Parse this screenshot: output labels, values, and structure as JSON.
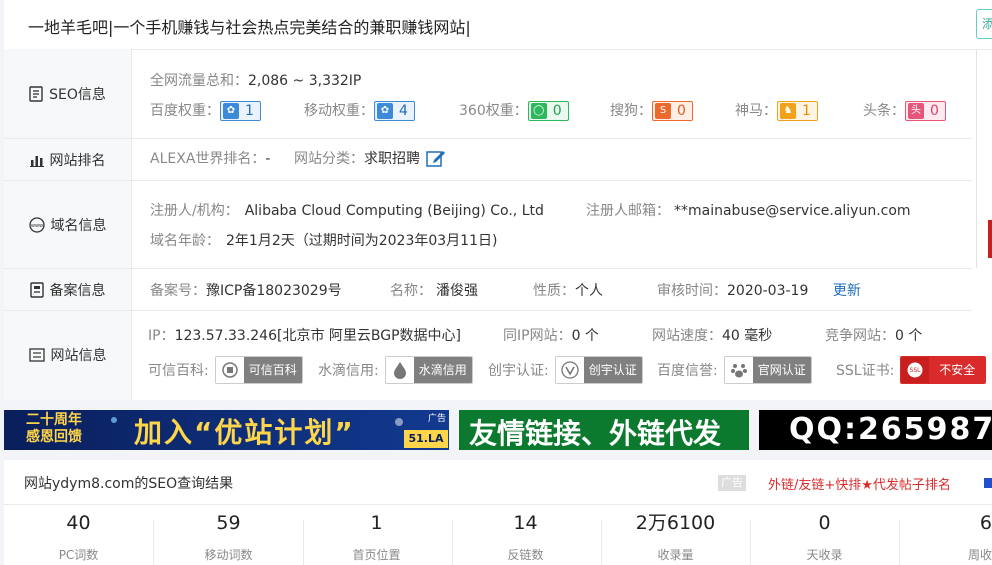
{
  "page_title": "一地羊毛吧|一个手机赚钱与社会热点完美结合的兼职赚钱网站|",
  "cut_button": "添",
  "sections": {
    "seo": "SEO信息",
    "rank": "网站排名",
    "domain": "域名信息",
    "icp": "备案信息",
    "site": "网站信息"
  },
  "seo": {
    "traffic_label": "全网流量总和：",
    "traffic_value": "2,086 ~ 3,332IP",
    "weights": [
      {
        "label": "百度权重：",
        "value": "1",
        "icon": "paw-icon",
        "color": "#3d8ad8"
      },
      {
        "label": "移动权重：",
        "value": "4",
        "icon": "paw-icon",
        "color": "#3d8ad8"
      },
      {
        "label": "360权重：",
        "value": "0",
        "icon": "360-icon",
        "color": "#2eb85c"
      },
      {
        "label": "搜狗：",
        "value": "0",
        "icon": "sogou-icon",
        "color": "#ec6a2c"
      },
      {
        "label": "神马：",
        "value": "1",
        "icon": "shenma-icon",
        "color": "#f2a11b"
      },
      {
        "label": "头条：",
        "value": "0",
        "icon": "toutiao-icon",
        "color": "#e8557a"
      }
    ]
  },
  "rank": {
    "alexa_label": "ALEXA世界排名：",
    "alexa_value": "-",
    "category_label": "网站分类：",
    "category_value": "求职招聘"
  },
  "domain": {
    "registrant_label": "注册人/机构：",
    "registrant_value": "Alibaba Cloud Computing (Beijing) Co., Ltd",
    "email_label": "注册人邮箱：",
    "email_value": "**mainabuse@service.aliyun.com",
    "age_label": "域名年龄：",
    "age_value": "2年1月2天（过期时间为2023年03月11日)"
  },
  "icp": {
    "number_label": "备案号：",
    "number_value": "豫ICP备18023029号",
    "name_label": "名称：",
    "name_value": "潘俊强",
    "type_label": "性质：",
    "type_value": "个人",
    "audit_label": "审核时间：",
    "audit_value": "2020-03-19",
    "update_link": "更新"
  },
  "site": {
    "ip_label": "IP：",
    "ip_value": "123.57.33.246[北京市 阿里云BGP数据中心]",
    "same_ip_label": "同IP网站：",
    "same_ip_value": "0 个",
    "speed_label": "网站速度：",
    "speed_value": "40 毫秒",
    "compete_label": "竞争网站：",
    "compete_value": "0 个",
    "creds": [
      {
        "label": "可信百科:",
        "badge": "可信百科",
        "icon": "trust-icon"
      },
      {
        "label": "水滴信用:",
        "badge": "水滴信用",
        "icon": "drop-icon"
      },
      {
        "label": "创宇认证:",
        "badge": "创宇认证",
        "icon": "shield-v-icon"
      },
      {
        "label": "百度信誉:",
        "badge": "官网认证",
        "icon": "paw-icon"
      },
      {
        "label": "SSL证书:",
        "badge": "不安全",
        "icon": "ssl-icon"
      }
    ]
  },
  "ads": {
    "ad1_left": "二十周年\n感恩回馈",
    "ad1_main": "加入“优站计划”",
    "ad1_tag": "广告",
    "ad1_brand": "51.LA",
    "ad2": "友情链接、外链代发",
    "ad3": "QQ:265987"
  },
  "results": {
    "title": "网站ydym8.com的SEO查询结果",
    "ad_tag": "广告",
    "ad_link": "外链/友链+快排★代发帖子排名",
    "stats": [
      {
        "value": "40",
        "label": "PC词数"
      },
      {
        "value": "59",
        "label": "移动词数"
      },
      {
        "value": "1",
        "label": "首页位置"
      },
      {
        "value": "14",
        "label": "反链数"
      },
      {
        "value": "2万6100",
        "label": "收录量"
      },
      {
        "value": "0",
        "label": "天收录"
      },
      {
        "value": "6",
        "label": "周收"
      }
    ]
  }
}
